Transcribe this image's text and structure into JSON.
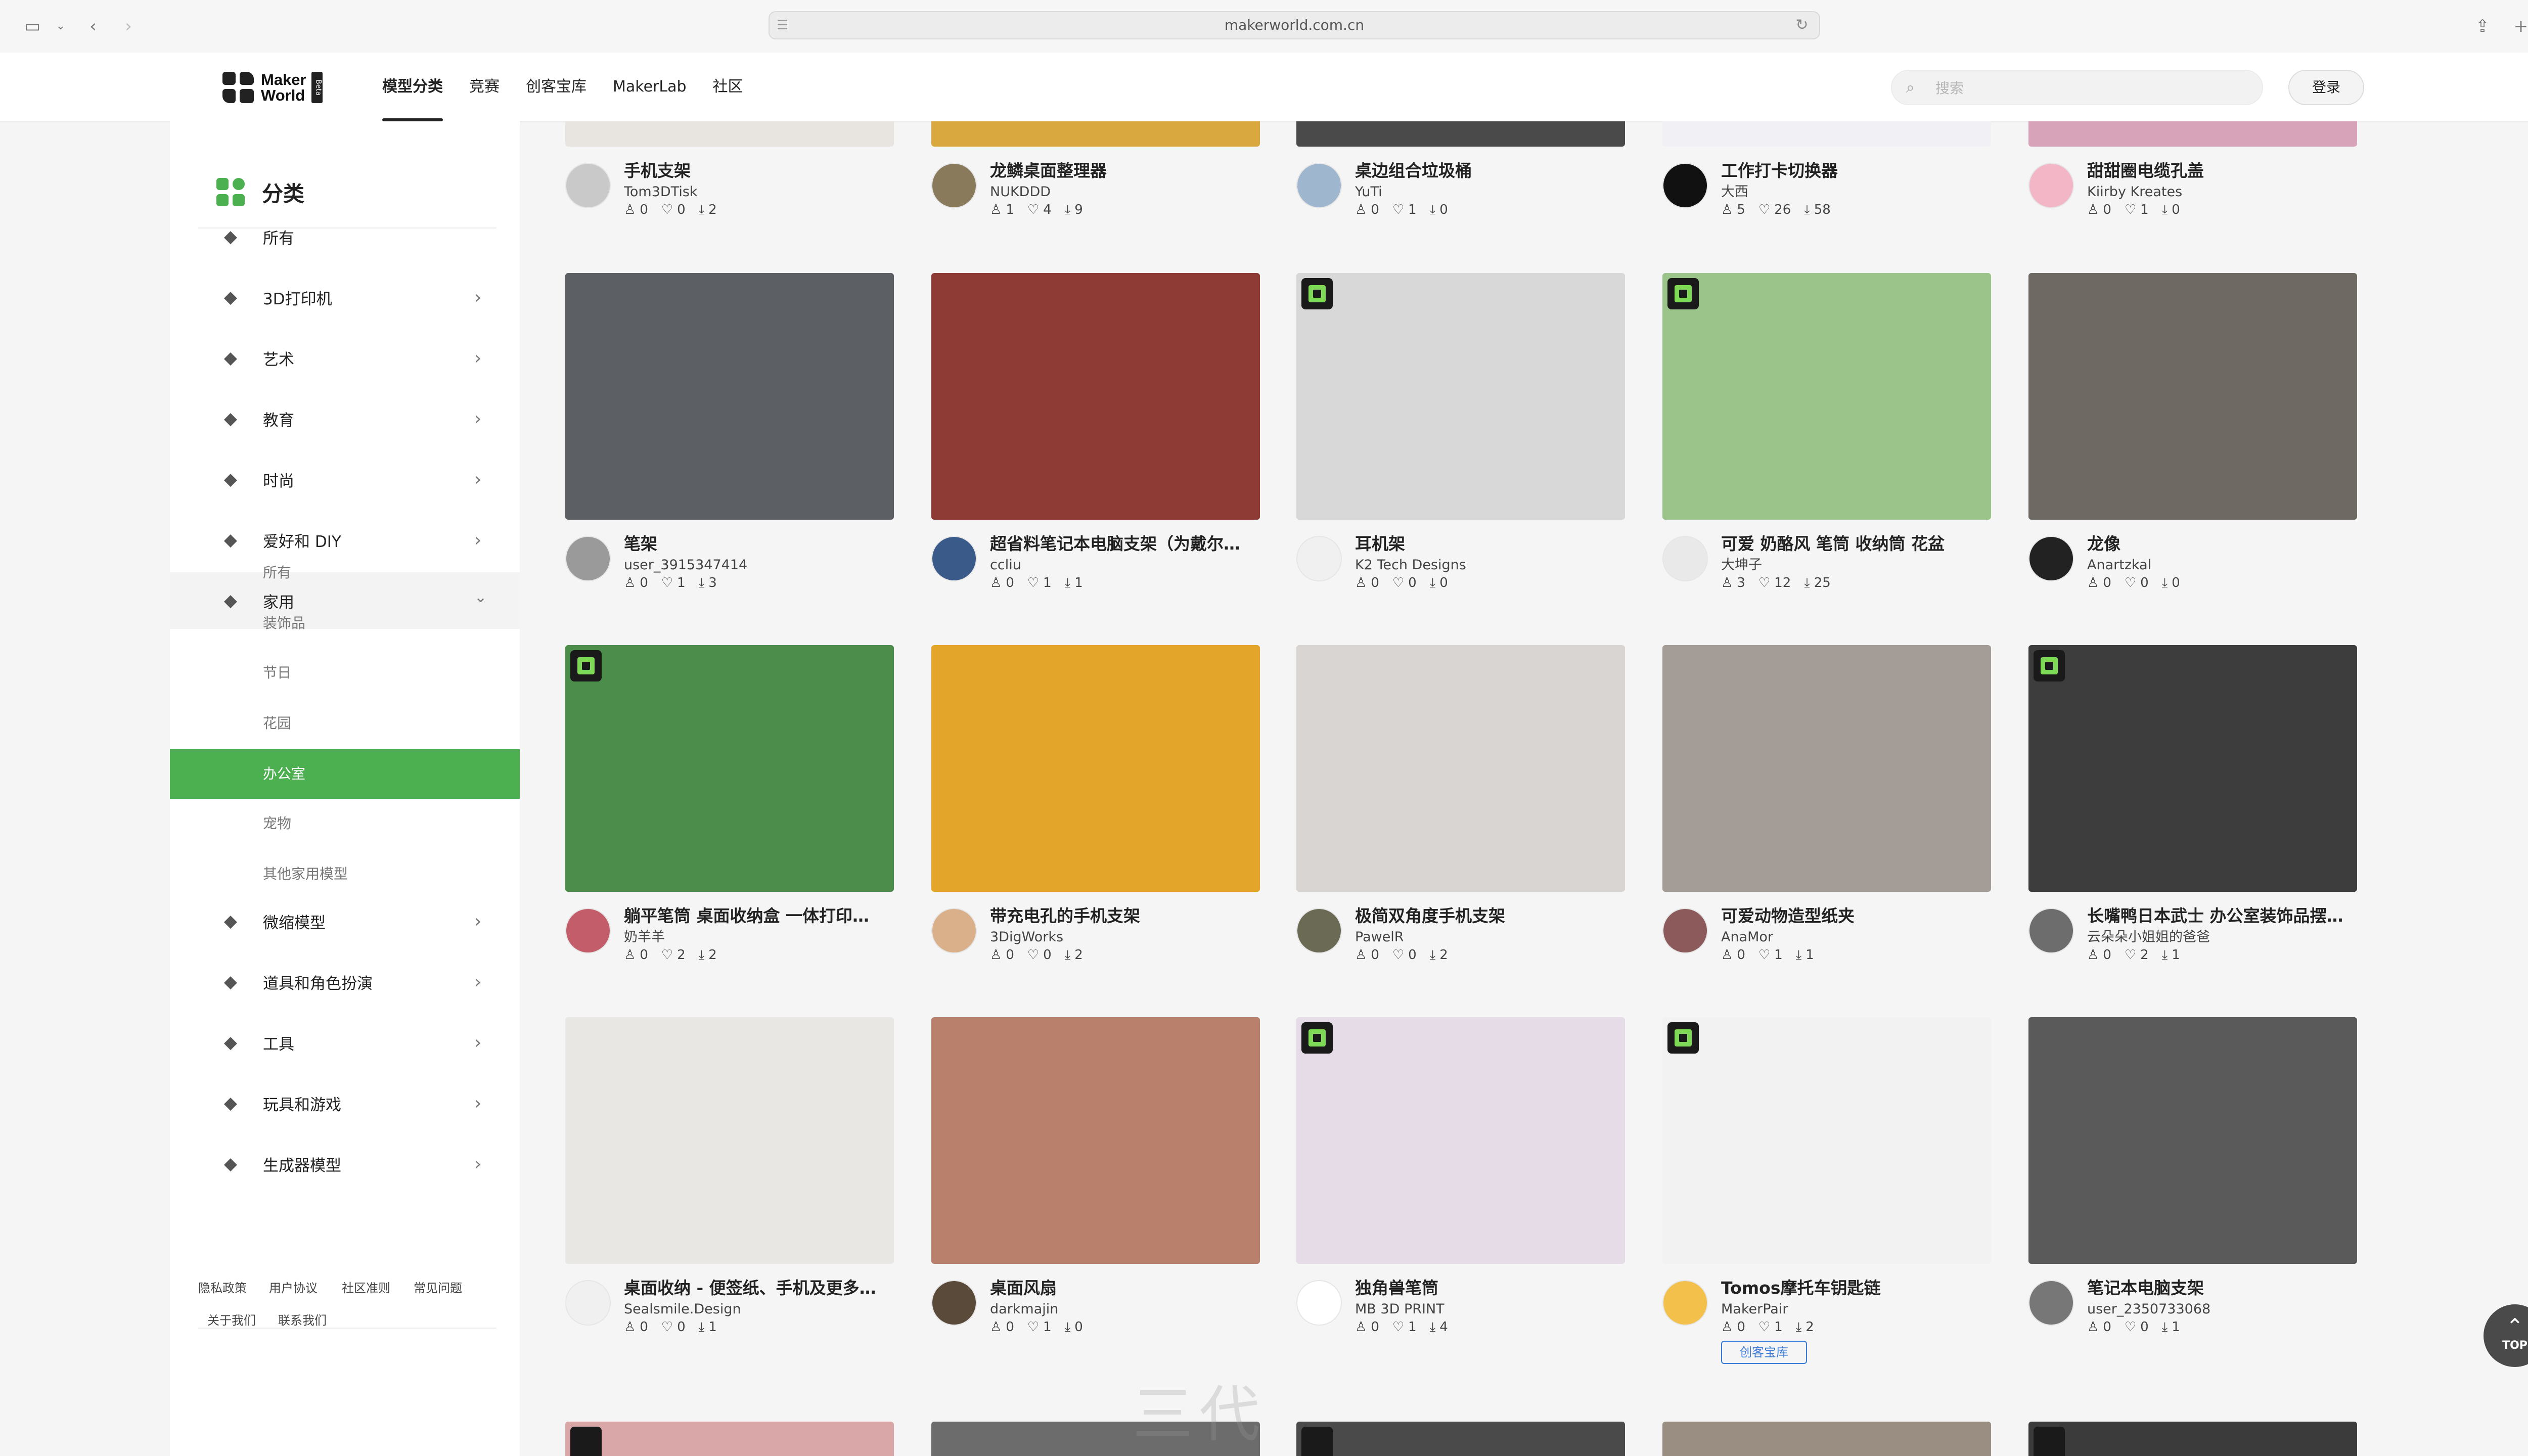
{
  "browser": {
    "url": "makerworld.com.cn"
  },
  "header": {
    "logo_line1": "Maker",
    "logo_line2": "World",
    "logo_beta": "Beta",
    "nav": [
      "模型分类",
      "竞赛",
      "创客宝库",
      "MakerLab",
      "社区"
    ],
    "search_placeholder": "搜索",
    "login": "登录"
  },
  "sidebar": {
    "title": "分类",
    "categories": [
      {
        "label": "所有",
        "icon": "layers-icon"
      },
      {
        "label": "3D打印机",
        "icon": "printer-icon"
      },
      {
        "label": "艺术",
        "icon": "palette-icon"
      },
      {
        "label": "教育",
        "icon": "education-icon"
      },
      {
        "label": "时尚",
        "icon": "fashion-icon"
      },
      {
        "label": "爱好和 DIY",
        "icon": "hobby-icon"
      },
      {
        "label": "家用",
        "icon": "household-icon"
      }
    ],
    "subcategories": [
      "所有",
      "装饰品",
      "节日",
      "花园",
      "办公室",
      "宠物",
      "其他家用模型"
    ],
    "active_sub": "办公室",
    "categories_after": [
      {
        "label": "微缩模型",
        "icon": "miniature-icon"
      },
      {
        "label": "道具和角色扮演",
        "icon": "props-icon"
      },
      {
        "label": "工具",
        "icon": "tools-icon"
      },
      {
        "label": "玩具和游戏",
        "icon": "gamepad-icon"
      },
      {
        "label": "生成器模型",
        "icon": "generator-icon"
      }
    ],
    "footer_links": [
      "隐私政策",
      "用户协议",
      "社区准则",
      "常见问题",
      "关于我们",
      "联系我们"
    ]
  },
  "models": [
    {
      "title": "手机支架",
      "author": "Tom3DTisk",
      "stats": [
        "0",
        "0",
        "2"
      ],
      "color": "#e8e4df"
    },
    {
      "title": "龙鳞桌面整理器",
      "author": "NUKDDD",
      "stats": [
        "1",
        "4",
        "9"
      ],
      "color": "#d9a93f"
    },
    {
      "title": "桌边组合垃圾桶",
      "author": "YuTi",
      "stats": [
        "0",
        "1",
        "0"
      ],
      "color": "#4a4a4a"
    },
    {
      "title": "工作打卡切换器",
      "author": "大西",
      "stats": [
        "5",
        "26",
        "58"
      ],
      "color": "#f0f0f5"
    },
    {
      "title": "甜甜圈电缆孔盖",
      "author": "Kiirby Kreates",
      "stats": [
        "0",
        "1",
        "0"
      ],
      "color": "#d6a3b8"
    },
    {
      "title": "笔架",
      "author": "user_3915347414",
      "stats": [
        "0",
        "1",
        "3"
      ],
      "color": "#5c5f63"
    },
    {
      "title": "超省料笔记本电脑支架（为戴尔…",
      "author": "ccliu",
      "stats": [
        "0",
        "1",
        "1"
      ],
      "color": "#8f3b35"
    },
    {
      "title": "耳机架",
      "author": "K2 Tech Designs",
      "stats": [
        "0",
        "0",
        "0"
      ],
      "color": "#d8d8d8"
    },
    {
      "title": "可爱 奶酪风 笔筒 收纳筒 花盆",
      "author": "大坤子",
      "stats": [
        "3",
        "12",
        "25"
      ],
      "color": "#9bc48a"
    },
    {
      "title": "龙像",
      "author": "Anartzkal",
      "stats": [
        "0",
        "0",
        "0"
      ],
      "color": "#6e6a63"
    },
    {
      "title": "躺平笔筒 桌面收纳盒 一体打印…",
      "author": "奶羊羊",
      "stats": [
        "0",
        "2",
        "2"
      ],
      "color": "#4c8d4c"
    },
    {
      "title": "带充电孔的手机支架",
      "author": "3DigWorks",
      "stats": [
        "0",
        "0",
        "2"
      ],
      "color": "#e3a62b"
    },
    {
      "title": "极简双角度手机支架",
      "author": "PawelR",
      "stats": [
        "0",
        "0",
        "2"
      ],
      "color": "#d9d5d3"
    },
    {
      "title": "可爱动物造型纸夹",
      "author": "AnaMor",
      "stats": [
        "0",
        "1",
        "1"
      ],
      "color": "#a49d97"
    },
    {
      "title": "长嘴鸭日本武士 办公室装饰品摆…",
      "author": "云朵朵小姐姐的爸爸",
      "stats": [
        "0",
        "2",
        "1"
      ],
      "color": "#3d3d3d"
    },
    {
      "title": "桌面收纳 - 便签纸、手机及更多…",
      "author": "Sealsmile.Design",
      "stats": [
        "0",
        "0",
        "1"
      ],
      "color": "#e9e7e4"
    },
    {
      "title": "桌面风扇",
      "author": "darkmajin",
      "stats": [
        "0",
        "1",
        "0"
      ],
      "color": "#b9806b"
    },
    {
      "title": "独角兽笔筒",
      "author": "MB 3D PRINT",
      "stats": [
        "0",
        "1",
        "4"
      ],
      "color": "#e6dce8"
    },
    {
      "title": "Tomos摩托车钥匙链",
      "author": "MakerPair",
      "stats": [
        "0",
        "1",
        "2"
      ],
      "color": "#f2f2f2",
      "tag": "创客宝库"
    },
    {
      "title": "笔记本电脑支架",
      "author": "user_2350733068",
      "stats": [
        "0",
        "0",
        "1"
      ],
      "color": "#5a5a5a"
    }
  ],
  "partial_row_colors": [
    "#d9a7a7",
    "#6c6c6c",
    "#4a4a4a",
    "#9a8e82",
    "#3b3b3b"
  ],
  "top_button": "TOP",
  "watermark": "三代"
}
